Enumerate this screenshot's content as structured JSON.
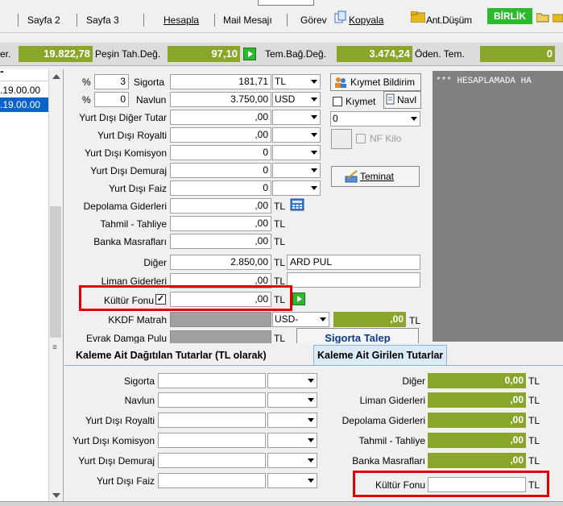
{
  "tabs": {
    "sayfa2": "Sayfa 2",
    "sayfa3": "Sayfa 3",
    "hesapla": "Hesapla",
    "mail": "Mail Mesajı",
    "gorev": "Görev",
    "kopyala": "Kopyala",
    "ant": "Ant.Düşüm",
    "birlik": "BİRLİK"
  },
  "totals": {
    "left_label": "er.",
    "left_value": "19.822,78",
    "pesin_label": "Peşin Tah.Değ.",
    "pesin_value": "97,10",
    "tem_label": "Tem.Bağ.Değ.",
    "tem_value": "3.474,24",
    "oden_label": "Öden. Tem.",
    "oden_value": "0"
  },
  "left_list": {
    "row1": ".19.00.00",
    "row2": ".19.00.00"
  },
  "rows": {
    "sigorta": {
      "pct_symbol": "%",
      "pct_value": "3",
      "label": "Sigorta",
      "value": "181,71",
      "currency": "TL"
    },
    "navlun": {
      "pct_symbol": "%",
      "pct_value": "0",
      "label": "Navlun",
      "value": "3.750,00",
      "currency": "USD"
    },
    "ydiger": {
      "label": "Yurt Dışı Diğer Tutar",
      "value": ",00"
    },
    "yroyalti": {
      "label": "Yurt Dışı Royalti",
      "value": ",00"
    },
    "ykomisyon": {
      "label": "Yurt Dışı Komisyon",
      "value": "0"
    },
    "ydemuraj": {
      "label": "Yurt Dışı Demuraj",
      "value": "0"
    },
    "yfaiz": {
      "label": "Yurt Dışı Faiz",
      "value": "0"
    },
    "depolama": {
      "label": "Depolama Giderleri",
      "value": ",00",
      "currency": "TL"
    },
    "tahmil": {
      "label": "Tahmil - Tahliye",
      "value": ",00",
      "currency": "TL"
    },
    "banka": {
      "label": "Banka Masrafları",
      "value": ",00",
      "currency": "TL"
    },
    "diger": {
      "label": "Diğer",
      "value": "2.850,00",
      "currency": "TL",
      "note": "ARD PUL"
    },
    "liman": {
      "label": "Liman Giderleri",
      "value": ",00",
      "currency": "TL"
    },
    "kultur": {
      "label": "Kültür Fonu",
      "check": "✓",
      "value": ",00",
      "currency": "TL"
    },
    "kkdf": {
      "label": "KKDF Matrah",
      "currency": "USD",
      "dash": "-",
      "value": ",00",
      "currency2": "TL"
    },
    "evrak": {
      "label": "Evrak Damga Pulu",
      "currency": "TL"
    }
  },
  "side": {
    "kiymet_bildirim": "Kıymet Bildirim",
    "kiymet": "Kıymet",
    "navl": "Navl",
    "dd_value": "0",
    "nf_kilo": "NF Kilo",
    "teminat": "Teminat",
    "sigorta_talep": "Sigorta Talep"
  },
  "log": {
    "text": "*** HESAPLAMADA HA"
  },
  "lower_tabs": {
    "tab1": "Kaleme Ait Dağıtılan Tutarlar (TL olarak)",
    "tab2": "Kaleme Ait Girilen Tutarlar"
  },
  "lower": {
    "left": [
      "Sigorta",
      "Navlun",
      "Yurt Dışı Royalti",
      "Yurt Dışı Komisyon",
      "Yurt Dışı Demuraj",
      "Yurt Dışı Faiz"
    ],
    "right": [
      {
        "label": "Diğer",
        "value": "0,00",
        "currency": "TL"
      },
      {
        "label": "Liman Giderleri",
        "value": ",00",
        "currency": "TL"
      },
      {
        "label": "Depolama Giderleri",
        "value": ",00",
        "currency": "TL"
      },
      {
        "label": "Tahmil - Tahliye",
        "value": ",00",
        "currency": "TL"
      },
      {
        "label": "Banka Masrafları",
        "value": ",00",
        "currency": "TL"
      },
      {
        "label": "Kültür Fonu",
        "value": "",
        "currency": "TL"
      }
    ]
  },
  "colors": {
    "green": "#8aa62a",
    "grey": "#a0a0a0",
    "red": "#e00000",
    "tab_active": "#dbeaf7"
  }
}
